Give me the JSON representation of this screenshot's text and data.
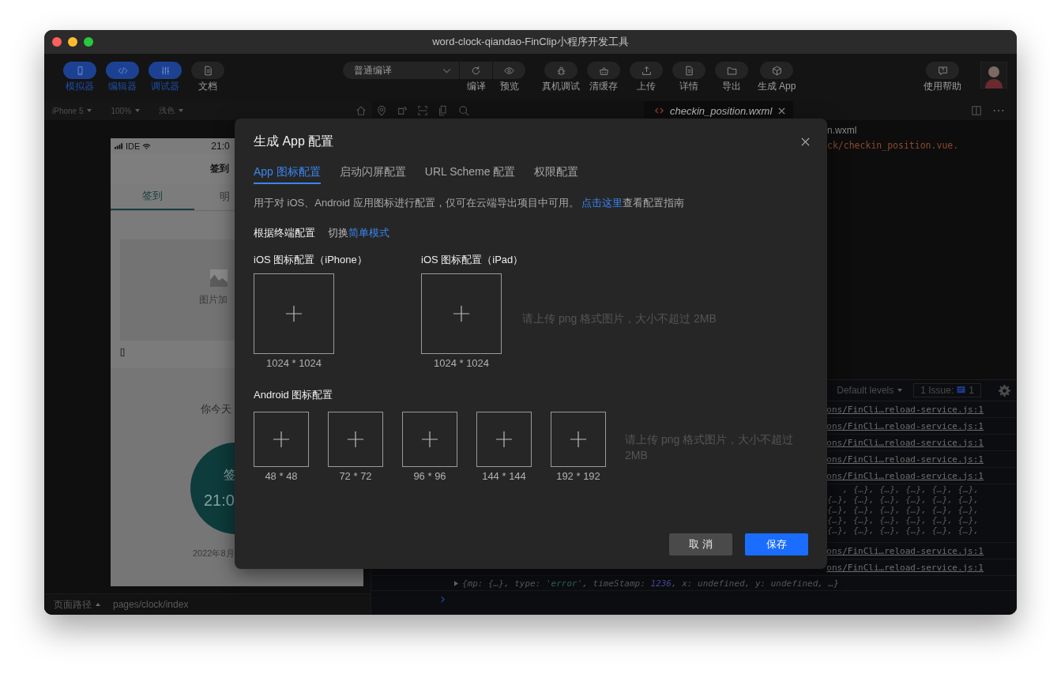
{
  "window": {
    "title": "word-clock-qiandao-FinClip小程序开发工具"
  },
  "toolbar": {
    "views": [
      {
        "label": "模拟器",
        "on": true
      },
      {
        "label": "编辑器",
        "on": true
      },
      {
        "label": "调试器",
        "on": true
      },
      {
        "label": "文档",
        "on": false
      }
    ],
    "compile": {
      "mode": "普通编译",
      "actions": [
        "编译",
        "预览"
      ]
    },
    "actions": [
      "真机调试",
      "清缓存",
      "上传",
      "详情",
      "导出",
      "生成 App"
    ],
    "help": "使用帮助"
  },
  "simulator": {
    "settings": [
      "iPhone 5",
      "100%",
      "浅色"
    ],
    "phone": {
      "carrier": "IDE",
      "time": "21:0",
      "nav_title": "签到",
      "tabs": [
        {
          "label": "签到",
          "selected": true
        },
        {
          "label": "明",
          "selected": false
        }
      ],
      "image_text": "图片加",
      "brackets": "[]",
      "prompt": "你今天",
      "circle_label": "签",
      "circle_time": "21:0",
      "date": "2022年8月"
    }
  },
  "editor": {
    "tab": "checkin_position.wxml",
    "lines": [
      {
        "kind": "plain",
        "text": "n.wxml"
      },
      {
        "kind": "path",
        "text": "ck/checkin_position.vue."
      }
    ]
  },
  "console": {
    "filter": "Default levels",
    "issues": {
      "label": "1 Issue:",
      "count": "1"
    },
    "rows": [
      {
        "kind": "link",
        "text": "ons/FinCli…reload-service.js:1"
      },
      {
        "kind": "link",
        "text": "ons/FinCli…reload-service.js:1"
      },
      {
        "kind": "link",
        "text": "ons/FinCli…reload-service.js:1"
      },
      {
        "kind": "link",
        "text": "ons/FinCli…reload-service.js:1"
      },
      {
        "kind": "link",
        "text": "ons/FinCli…reload-service.js:1"
      },
      {
        "kind": "object",
        "text": ", {…}, {…}, {…}, {…}, {…},"
      },
      {
        "kind": "object",
        "text": "{…}, {…}, {…}, {…}, {…}, {…},"
      },
      {
        "kind": "object",
        "text": "{…}, {…}, {…}, {…}, {…}, {…},"
      },
      {
        "kind": "object",
        "text": "{…}, {…}, {…}, {…}, {…}, {…},"
      },
      {
        "kind": "object",
        "text": "{…}, {…}, {…}, {…}, {…}, {…},"
      },
      {
        "kind": "link",
        "text": "ons/FinCli…reload-service.js:1"
      },
      {
        "kind": "link",
        "text": "ons/FinCli…reload-service.js:1"
      }
    ],
    "log": [
      {
        "kind": "plain",
        "text": "{mp: {…}, type: "
      },
      {
        "kind": "string",
        "text": "'error'"
      },
      {
        "kind": "plain",
        "text": ", timeStamp: "
      },
      {
        "kind": "number",
        "text": "1236"
      },
      {
        "kind": "plain",
        "text": ", x: undefined, y: undefined, …}"
      }
    ]
  },
  "status_bar": {
    "label": "页面路径",
    "path": "pages/clock/index"
  },
  "dialog": {
    "title": "生成 App 配置",
    "tabs": [
      {
        "label": "App 图标配置",
        "selected": true
      },
      {
        "label": "启动闪屏配置",
        "selected": false
      },
      {
        "label": "URL Scheme 配置",
        "selected": false
      },
      {
        "label": "权限配置",
        "selected": false
      }
    ],
    "description": {
      "text": "用于对 iOS、Android 应用图标进行配置，仅可在云端导出项目中可用。 ",
      "link": "点击这里",
      "after": "查看配置指南"
    },
    "mode": {
      "label": "根据终端配置",
      "switch": "切换",
      "link": "简单模式"
    },
    "ios": [
      {
        "label": "iOS 图标配置（iPhone）",
        "size": "1024 * 1024"
      },
      {
        "label": "iOS 图标配置（iPad）",
        "size": "1024 * 1024"
      }
    ],
    "ios_hint": "请上传 png 格式图片，大小不超过 2MB",
    "android": {
      "label": "Android 图标配置",
      "sizes": [
        "48 * 48",
        "72 * 72",
        "96 * 96",
        "144 * 144",
        "192 * 192"
      ],
      "hint": "请上传 png 格式图片，大小不超过 2MB"
    },
    "buttons": {
      "cancel": "取 消",
      "save": "保存"
    }
  }
}
